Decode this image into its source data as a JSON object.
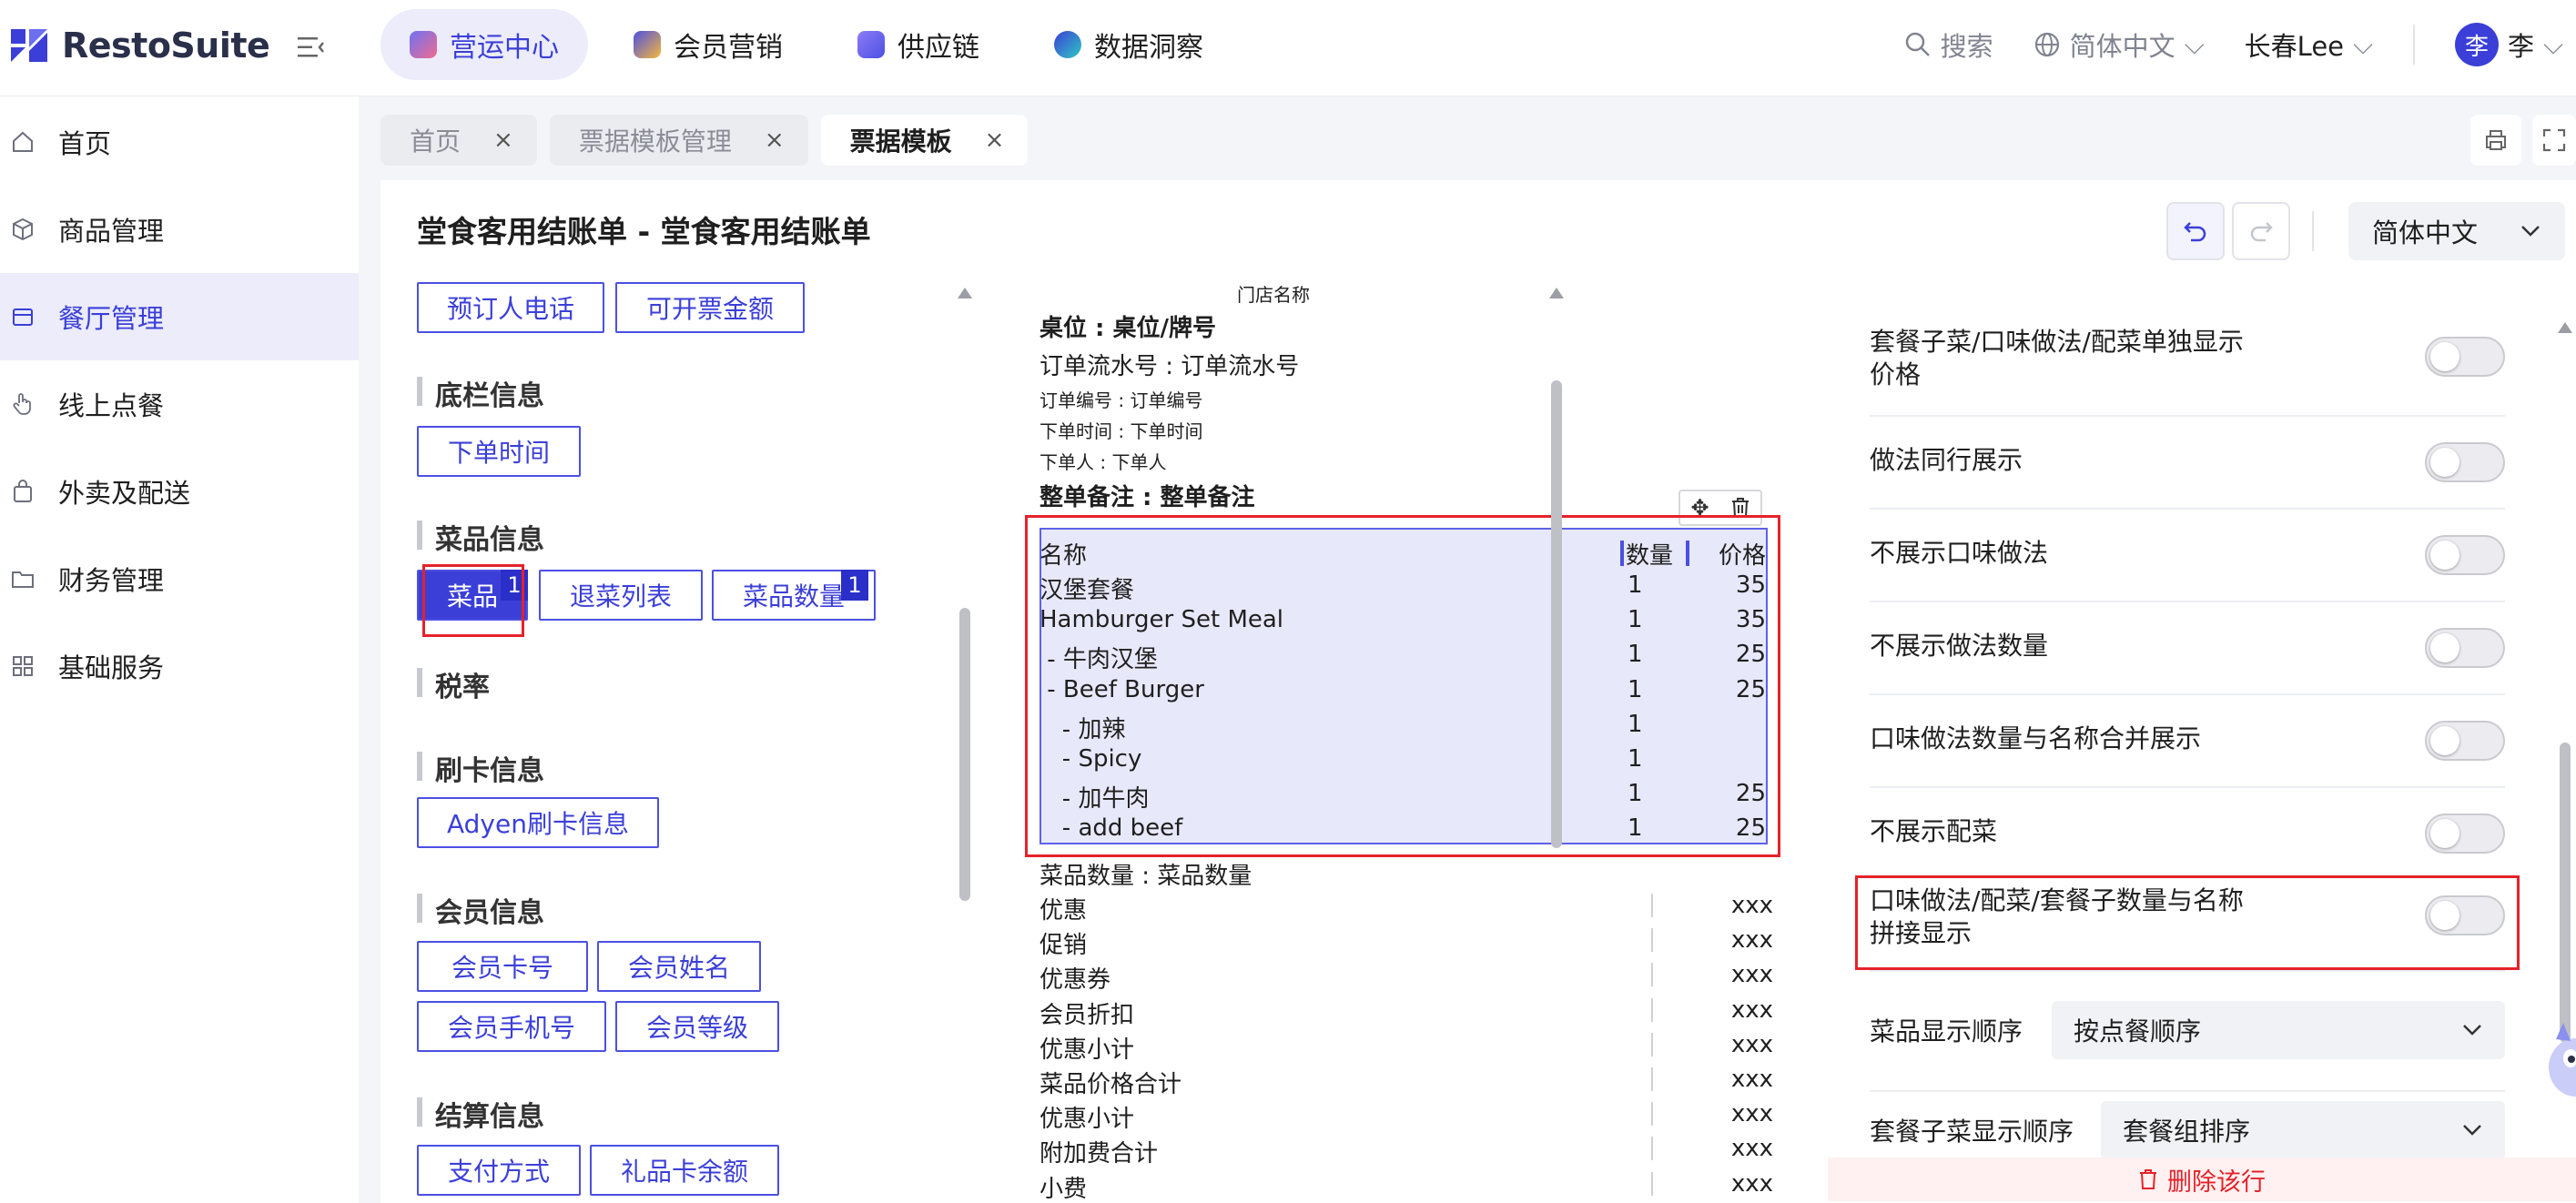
{
  "brand": {
    "name": "RestoSuite",
    "accent": "#3b3fd8"
  },
  "topnav": {
    "items": [
      {
        "label": "营运中心",
        "icon": "ops-center-icon",
        "active": true
      },
      {
        "label": "会员营销",
        "icon": "member-marketing-icon"
      },
      {
        "label": "供应链",
        "icon": "supply-chain-icon"
      },
      {
        "label": "数据洞察",
        "icon": "data-insight-icon"
      }
    ],
    "search": "搜索",
    "language": "简体中文",
    "store": "长春Lee",
    "avatar_char": "李",
    "user": "李"
  },
  "sidebar": {
    "items": [
      {
        "label": "首页",
        "icon": "home-icon"
      },
      {
        "label": "商品管理",
        "icon": "cube-icon"
      },
      {
        "label": "餐厅管理",
        "icon": "restaurant-icon",
        "active": true
      },
      {
        "label": "线上点餐",
        "icon": "hand-tap-icon"
      },
      {
        "label": "外卖及配送",
        "icon": "bag-icon"
      },
      {
        "label": "财务管理",
        "icon": "folder-icon"
      },
      {
        "label": "基础服务",
        "icon": "grid-icon"
      }
    ]
  },
  "tabs": [
    {
      "label": "首页",
      "close": "×"
    },
    {
      "label": "票据模板管理",
      "close": "×"
    },
    {
      "label": "票据模板",
      "close": "×",
      "active": true
    }
  ],
  "page": {
    "title": "堂食客用结账单 - 堂食客用结账单",
    "language": "简体中文"
  },
  "fields": {
    "top_buttons": [
      "预订人电话",
      "可开票金额"
    ],
    "footer": {
      "title": "底栏信息",
      "buttons": [
        "下单时间"
      ]
    },
    "dish": {
      "title": "菜品信息",
      "buttons": [
        "菜品",
        "退菜列表",
        "菜品数量"
      ],
      "badge_dish": "1",
      "badge_qty": "1"
    },
    "tax": {
      "title": "税率"
    },
    "card": {
      "title": "刷卡信息",
      "buttons": [
        "Adyen刷卡信息"
      ]
    },
    "member": {
      "title": "会员信息",
      "buttons": [
        "会员卡号",
        "会员姓名",
        "会员手机号",
        "会员等级"
      ]
    },
    "settle": {
      "title": "结算信息",
      "buttons": [
        "支付方式",
        "礼品卡余额"
      ]
    }
  },
  "preview": {
    "store_name": "门店名称",
    "table": "桌位 : 桌位/牌号",
    "serial": "订单流水号 : 订单流水号",
    "order_no": "订单编号 : 订单编号",
    "order_time": "下单时间 : 下单时间",
    "orderer": "下单人 : 下单人",
    "remark": "整单备注 : 整单备注",
    "dish_header": {
      "name": "名称",
      "qty": "数量",
      "price": "价格"
    },
    "dishes": [
      {
        "name": "汉堡套餐",
        "qty": "1",
        "price": "35"
      },
      {
        "name": "Hamburger Set Meal",
        "qty": "1",
        "price": "35"
      },
      {
        "name": " - 牛肉汉堡",
        "qty": "1",
        "price": "25"
      },
      {
        "name": " - Beef Burger",
        "qty": "1",
        "price": "25"
      },
      {
        "name": "   - 加辣",
        "qty": "1",
        "price": ""
      },
      {
        "name": "   - Spicy",
        "qty": "1",
        "price": ""
      },
      {
        "name": "   - 加牛肉",
        "qty": "1",
        "price": "25"
      },
      {
        "name": "   - add beef",
        "qty": "1",
        "price": "25"
      }
    ],
    "dish_count": "菜品数量 : 菜品数量",
    "summary": [
      {
        "name": "优惠",
        "value": "xxx"
      },
      {
        "name": "促销",
        "value": "xxx"
      },
      {
        "name": "优惠券",
        "value": "xxx"
      },
      {
        "name": "会员折扣",
        "value": "xxx"
      },
      {
        "name": "优惠小计",
        "value": "xxx"
      },
      {
        "name": "菜品价格合计",
        "value": "xxx"
      },
      {
        "name": "优惠小计",
        "value": "xxx"
      },
      {
        "name": "附加费合计",
        "value": "xxx"
      },
      {
        "name": "小费",
        "value": "xxx"
      }
    ]
  },
  "settings": {
    "toggles": [
      {
        "label": "套餐子菜/口味做法/配菜单独显示价格",
        "on": false
      },
      {
        "label": "做法同行展示",
        "on": false
      },
      {
        "label": "不展示口味做法",
        "on": false
      },
      {
        "label": "不展示做法数量",
        "on": false
      },
      {
        "label": "口味做法数量与名称合并展示",
        "on": false
      },
      {
        "label": "不展示配菜",
        "on": false
      },
      {
        "label": "口味做法/配菜/套餐子数量与名称拼接显示",
        "on": false
      }
    ],
    "dish_order": {
      "label": "菜品显示顺序",
      "value": "按点餐顺序"
    },
    "sub_order": {
      "label": "套餐子菜显示顺序",
      "value": "套餐组排序"
    },
    "delete": "删除该行"
  }
}
